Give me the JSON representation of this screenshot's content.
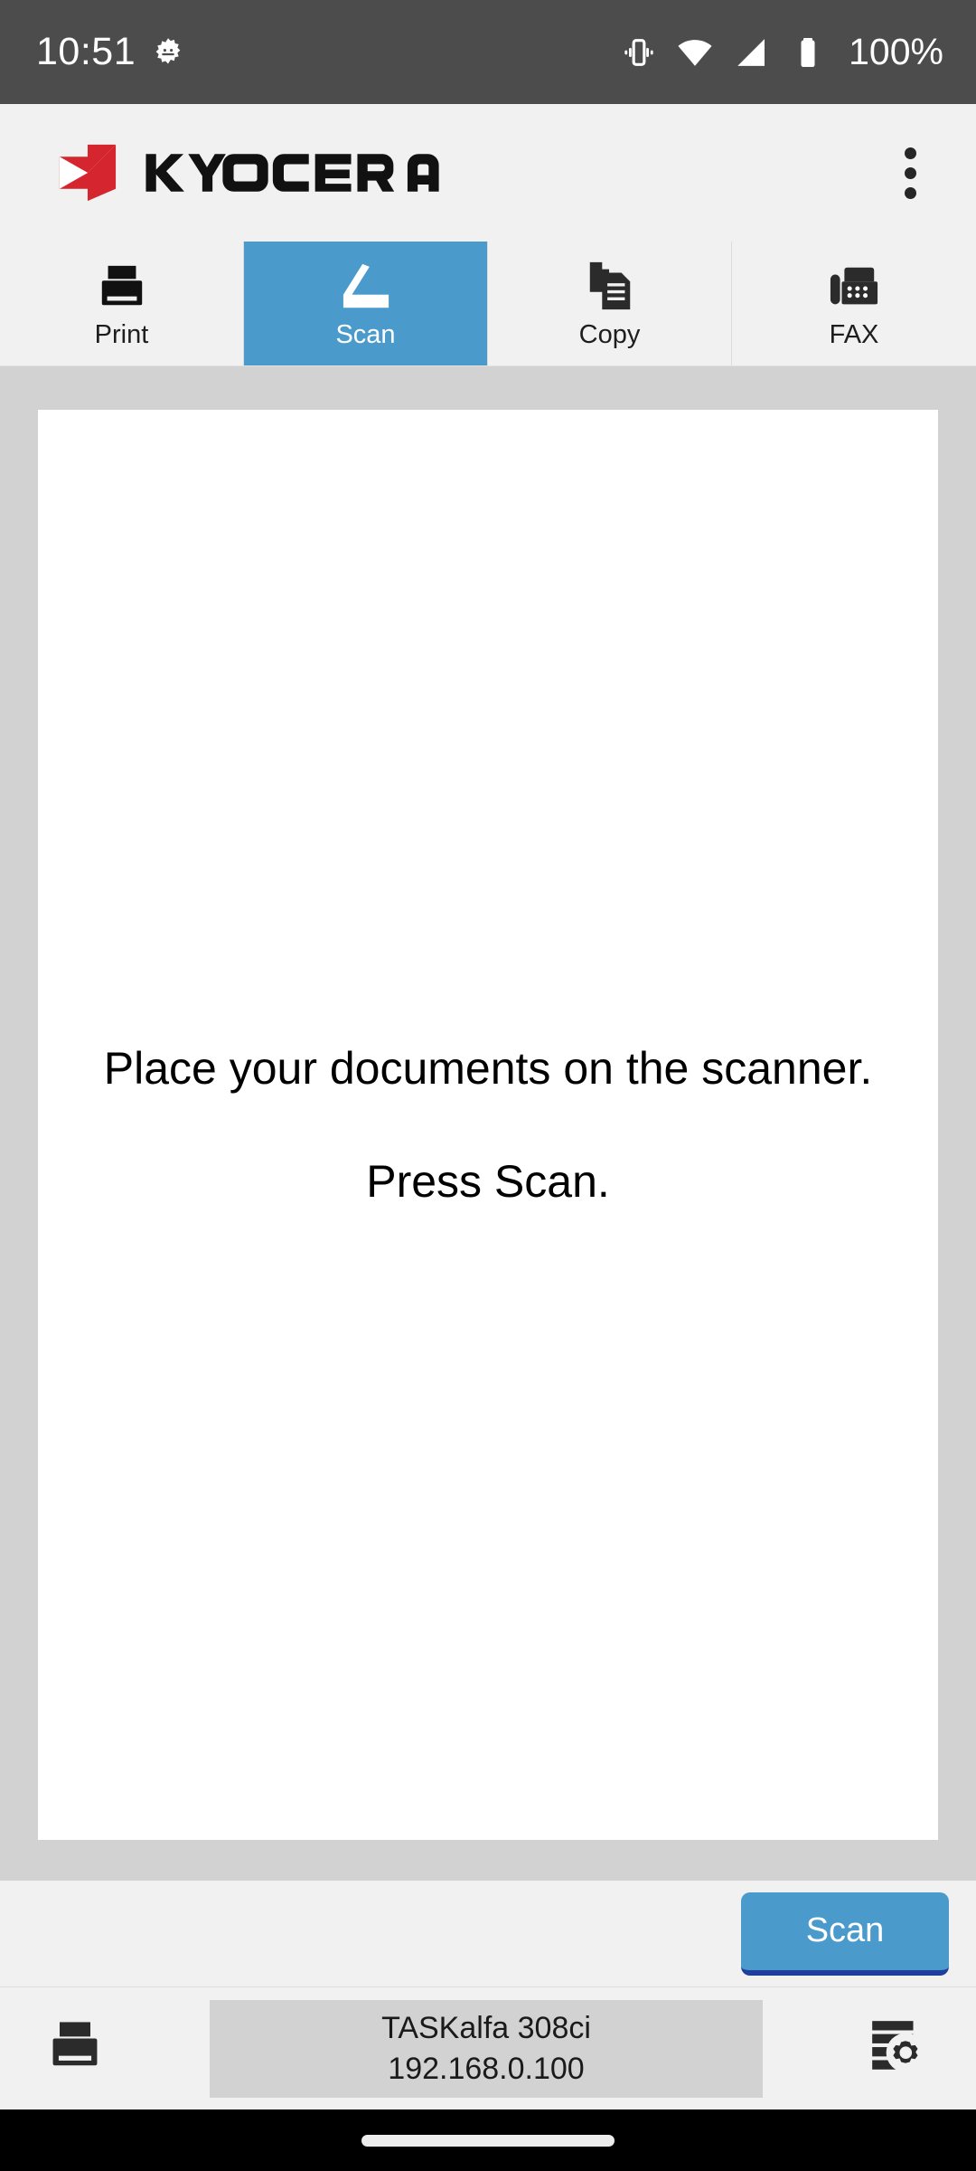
{
  "status_bar": {
    "time": "10:51",
    "icons": [
      "settings-gear-icon",
      "vibrate-icon",
      "wifi-icon",
      "cellular-signal-icon",
      "battery-icon"
    ],
    "battery_percent": "100%"
  },
  "header": {
    "brand": "KYOCERA",
    "brand_color": "#d5252f",
    "overflow_menu": "overflow-menu-icon"
  },
  "tabs": [
    {
      "label": "Print",
      "icon": "printer-icon",
      "active": false
    },
    {
      "label": "Scan",
      "icon": "scanner-icon",
      "active": true
    },
    {
      "label": "Copy",
      "icon": "copy-documents-icon",
      "active": false
    },
    {
      "label": "FAX",
      "icon": "fax-machine-icon",
      "active": false
    }
  ],
  "preview": {
    "message_line1": "Place your documents on the scanner.",
    "message_line2": "Press Scan."
  },
  "action_bar": {
    "scan_label": "Scan"
  },
  "device_bar": {
    "printer_icon": "printer-icon",
    "device_name": "TASKalfa 308ci",
    "device_ip": "192.168.0.100",
    "settings_icon": "device-settings-icon"
  },
  "colors": {
    "accent_blue": "#4a9acb",
    "status_bar": "#4c4c4c",
    "surface": "#f1f1f1",
    "preview_bg": "#d2d2d2",
    "brand_red": "#d5252f"
  }
}
